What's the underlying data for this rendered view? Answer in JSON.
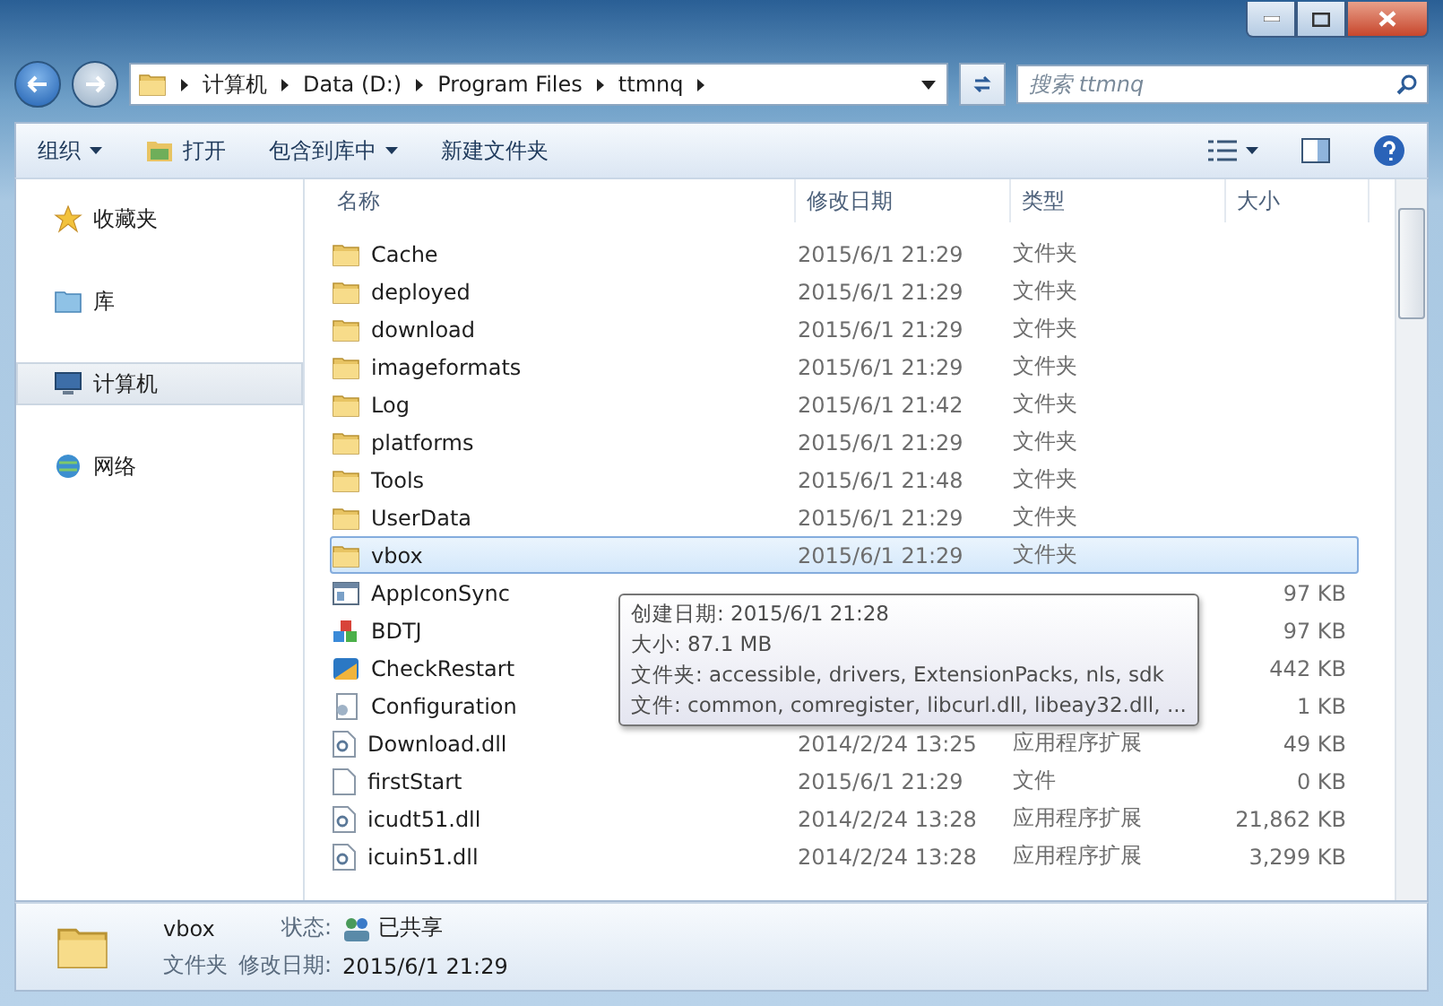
{
  "address": {
    "crumbs": [
      "计算机",
      "Data (D:)",
      "Program Files",
      "ttmnq"
    ]
  },
  "search": {
    "placeholder": "搜索 ttmnq"
  },
  "toolbar": {
    "items": [
      {
        "label": "组织",
        "kind": "menu"
      },
      {
        "label": "打开",
        "kind": "open"
      },
      {
        "label": "包含到库中",
        "kind": "menu"
      },
      {
        "label": "新建文件夹",
        "kind": "plain"
      }
    ]
  },
  "sidebar": {
    "items": [
      {
        "label": "收藏夹",
        "kind": "star",
        "selected": false
      },
      {
        "label": "库",
        "kind": "library",
        "selected": false
      },
      {
        "label": "计算机",
        "kind": "computer",
        "selected": true
      },
      {
        "label": "网络",
        "kind": "network",
        "selected": false
      }
    ]
  },
  "table": {
    "columns": [
      "名称",
      "修改日期",
      "类型",
      "大小"
    ],
    "rows": [
      {
        "name": "Cache",
        "kind": "folder",
        "date": "2015/6/1 21:29",
        "type": "文件夹",
        "size": "",
        "selected": false
      },
      {
        "name": "deployed",
        "kind": "folder",
        "date": "2015/6/1 21:29",
        "type": "文件夹",
        "size": "",
        "selected": false
      },
      {
        "name": "download",
        "kind": "folder",
        "date": "2015/6/1 21:29",
        "type": "文件夹",
        "size": "",
        "selected": false
      },
      {
        "name": "imageformats",
        "kind": "folder",
        "date": "2015/6/1 21:29",
        "type": "文件夹",
        "size": "",
        "selected": false
      },
      {
        "name": "Log",
        "kind": "folder",
        "date": "2015/6/1 21:42",
        "type": "文件夹",
        "size": "",
        "selected": false
      },
      {
        "name": "platforms",
        "kind": "folder",
        "date": "2015/6/1 21:29",
        "type": "文件夹",
        "size": "",
        "selected": false
      },
      {
        "name": "Tools",
        "kind": "folder",
        "date": "2015/6/1 21:48",
        "type": "文件夹",
        "size": "",
        "selected": false
      },
      {
        "name": "UserData",
        "kind": "folder",
        "date": "2015/6/1 21:29",
        "type": "文件夹",
        "size": "",
        "selected": false
      },
      {
        "name": "vbox",
        "kind": "folder",
        "date": "2015/6/1 21:29",
        "type": "文件夹",
        "size": "",
        "selected": true
      },
      {
        "name": "AppIconSync",
        "kind": "app",
        "date": "",
        "type": "",
        "size": "97 KB",
        "selected": false
      },
      {
        "name": "BDTJ",
        "kind": "cubes",
        "date": "",
        "type": "",
        "size": "97 KB",
        "selected": false
      },
      {
        "name": "CheckRestart",
        "kind": "exe",
        "date": "",
        "type": "",
        "size": "442 KB",
        "selected": false
      },
      {
        "name": "Configuration",
        "kind": "config",
        "date": "",
        "type": "",
        "size": "1 KB",
        "selected": false
      },
      {
        "name": "Download.dll",
        "kind": "dll",
        "date": "2014/2/24 13:25",
        "type": "应用程序扩展",
        "size": "49 KB",
        "selected": false
      },
      {
        "name": "firstStart",
        "kind": "file",
        "date": "2015/6/1 21:29",
        "type": "文件",
        "size": "0 KB",
        "selected": false
      },
      {
        "name": "icudt51.dll",
        "kind": "dll",
        "date": "2014/2/24 13:28",
        "type": "应用程序扩展",
        "size": "21,862 KB",
        "selected": false
      },
      {
        "name": "icuin51.dll",
        "kind": "dll",
        "date": "2014/2/24 13:28",
        "type": "应用程序扩展",
        "size": "3,299 KB",
        "selected": false
      }
    ]
  },
  "tooltip": {
    "lines": [
      "创建日期: 2015/6/1 21:28",
      "大小: 87.1 MB",
      "文件夹: accessible, drivers, ExtensionPacks, nls, sdk",
      "文件: common, comregister, libcurl.dll, libeay32.dll, ..."
    ]
  },
  "details": {
    "name": "vbox",
    "status_label": "状态:",
    "status": "已共享",
    "type": "文件夹",
    "modified_label": "修改日期:",
    "modified": "2015/6/1 21:29"
  }
}
